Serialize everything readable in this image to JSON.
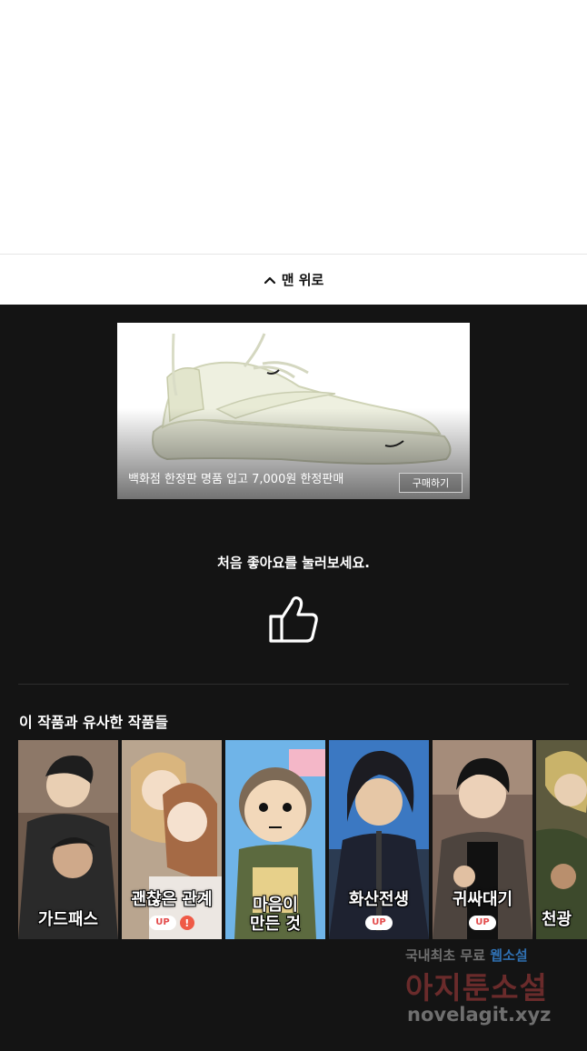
{
  "back_to_top": {
    "label": "맨 위로",
    "icon": "chevron-up-icon"
  },
  "ad": {
    "caption": "백화점 한정판 명품 입고 7,000원 한정판매",
    "button_label": "구매하기",
    "image": "white-sneaker"
  },
  "like": {
    "prompt": "처음 좋아요를 눌러보세요.",
    "icon": "thumbs-up-icon"
  },
  "similar": {
    "title": "이 작품과 유사한 작품들",
    "items": [
      {
        "title": "가드패스",
        "up": false,
        "warn": false
      },
      {
        "title": "괜찮은 관계",
        "up": true,
        "warn": true
      },
      {
        "title": "마음이\n만든 것",
        "up": false,
        "warn": false
      },
      {
        "title": "화산전생",
        "up": true,
        "warn": false
      },
      {
        "title": "귀싸대기",
        "up": true,
        "warn": false
      },
      {
        "title": "천광",
        "up": false,
        "warn": false
      }
    ],
    "up_label": "UP",
    "warn_label": "!"
  },
  "watermark": {
    "line1_a": "국내최초 무료",
    "line1_b": "웹소설",
    "line2": "아지툰소설",
    "line3": "novelagit.xyz"
  },
  "colors": {
    "background": "#141414",
    "up_text": "#e34b4b",
    "warn_badge": "#ef5a46"
  }
}
